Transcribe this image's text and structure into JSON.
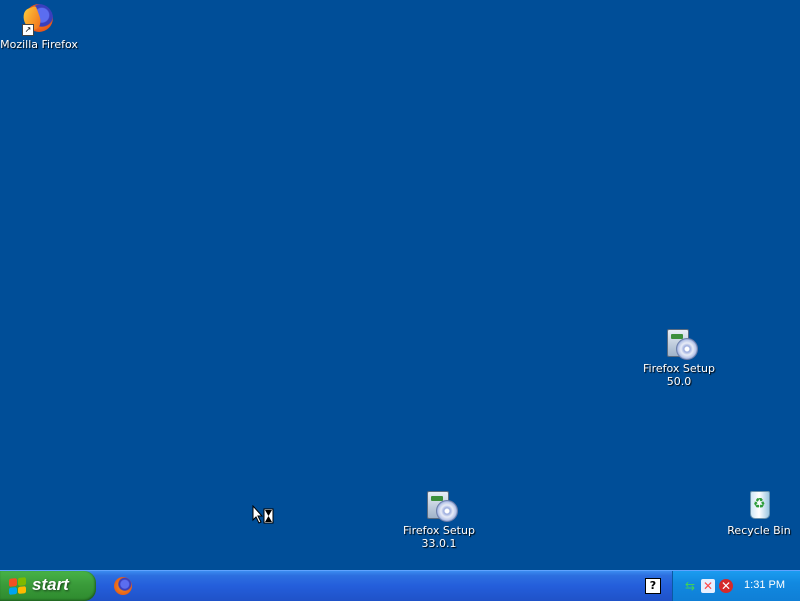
{
  "desktop": {
    "icons": [
      {
        "label": "Mozilla Firefox"
      },
      {
        "label": "Firefox Setup\n50.0"
      },
      {
        "label": "Firefox Setup\n33.0.1"
      },
      {
        "label": "Recycle Bin"
      }
    ]
  },
  "taskbar": {
    "start_label": "start",
    "tray": {
      "clock": "1:31 PM"
    }
  },
  "colors": {
    "desktop_bg": "#004e98",
    "taskbar_blue": "#245edb",
    "start_green": "#3a9b3a",
    "tray_blue": "#1289e0"
  },
  "icon_names": [
    "firefox-icon",
    "setup-package-icon",
    "recycle-bin-icon",
    "help-icon",
    "network-icon",
    "security-alert-icon",
    "shield-icon"
  ]
}
